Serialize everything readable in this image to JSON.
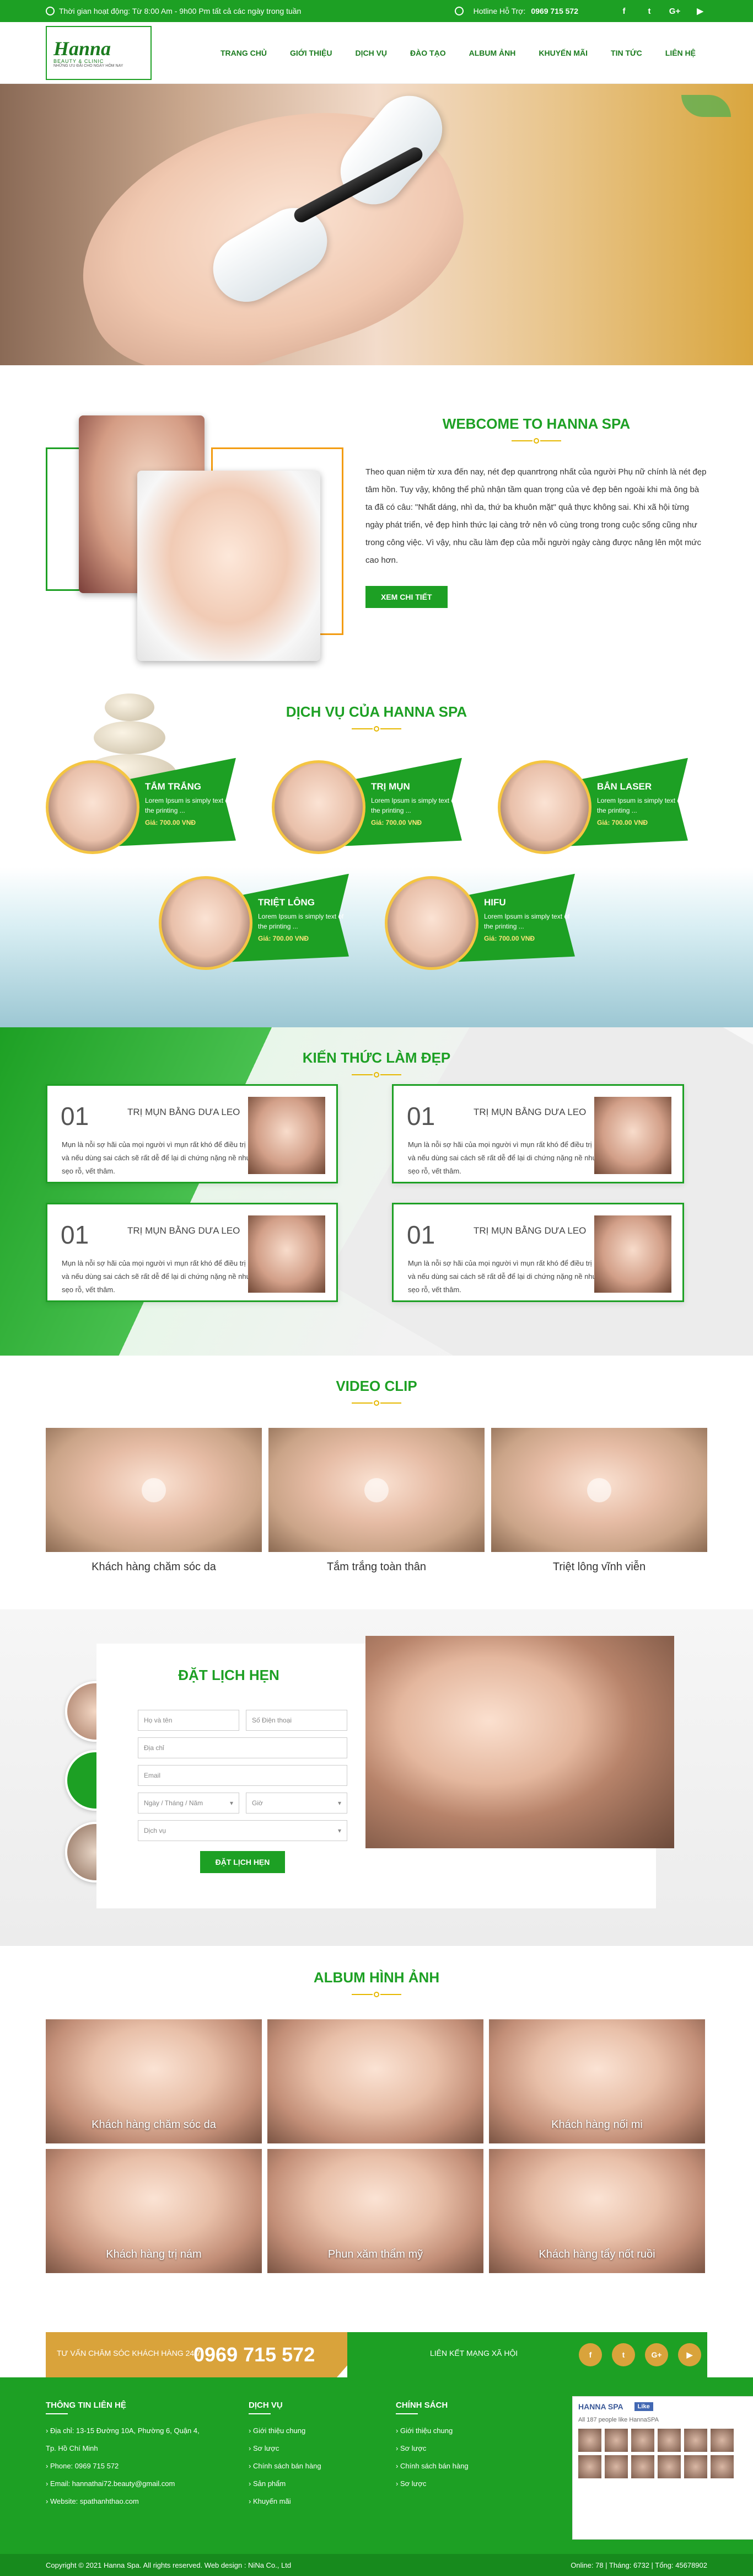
{
  "topbar": {
    "hours": "Thời gian hoạt động: Từ 8:00 Am - 9h00 Pm tất cả các ngày trong tuần",
    "hotline_label": "Hotline Hỗ Trợ:",
    "hotline": "0969 715 572",
    "social": [
      "f",
      "t",
      "G+",
      "▶"
    ]
  },
  "logo": {
    "name": "Hanna",
    "sub": "BEAUTY & CLINIC",
    "tag": "NHỮNG ƯU ĐÃI CHO NGÀY HÔM NAY"
  },
  "nav": [
    "TRANG CHỦ",
    "GIỚI THIỆU",
    "DỊCH VỤ",
    "ĐÀO TẠO",
    "ALBUM ẢNH",
    "KHUYẾN MÃI",
    "TIN TỨC",
    "LIÊN HỆ"
  ],
  "about": {
    "title": "WEBCOME TO HANNA SPA",
    "text": "Theo quan niệm từ xưa đến nay, nét đẹp quanrtrọng nhất của người Phụ nữ chính là nét đẹp tâm hồn. Tuy vậy, không thể phủ nhận tầm quan trọng của vẻ đẹp bên ngoài khi mà ông bà ta đã có câu: \"Nhất dáng, nhì da, thứ ba khuôn mặt\" quả thực không sai. Khi xã hội từng ngày phát triển, vẻ đẹp hình thức lại càng trở nên vô cùng trong trong cuộc sống cũng như trong công việc. Vì vậy, nhu cầu làm đẹp của mỗi người ngày càng được nâng lên một mức cao hơn.",
    "button": "XEM CHI TIẾT"
  },
  "services": {
    "title": "DỊCH VỤ CỦA HANNA SPA",
    "items": [
      {
        "name": "TẮM TRẮNG",
        "desc": "Lorem Ipsum is simply text of the printing ...",
        "price": "Giá: 700.00 VNĐ"
      },
      {
        "name": "TRỊ MỤN",
        "desc": "Lorem Ipsum is simply text of the printing ...",
        "price": "Giá: 700.00 VNĐ"
      },
      {
        "name": "BẮN LASER",
        "desc": "Lorem Ipsum is simply text of the printing ...",
        "price": "Giá: 700.00 VNĐ"
      },
      {
        "name": "TRIỆT LÔNG",
        "desc": "Lorem Ipsum is simply text of the printing ...",
        "price": "Giá: 700.00 VNĐ"
      },
      {
        "name": "HIFU",
        "desc": "Lorem Ipsum is simply text of the printing ...",
        "price": "Giá: 700.00 VNĐ"
      }
    ]
  },
  "knowledge": {
    "title": "KIẾN THỨC LÀM ĐẸP",
    "items": [
      {
        "no": "01",
        "name": "TRỊ MỤN BẰNG DƯA LEO",
        "desc": "Mụn là nỗi sợ hãi của mọi người vì mụn rất khó để điều trị và nếu dùng sai cách sẽ rất dễ để lại di chứng nặng nề như sẹo rỗ, vết thâm."
      },
      {
        "no": "01",
        "name": "TRỊ MỤN BẰNG DƯA LEO",
        "desc": "Mụn là nỗi sợ hãi của mọi người vì mụn rất khó để điều trị và nếu dùng sai cách sẽ rất dễ để lại di chứng nặng nề như sẹo rỗ, vết thâm."
      },
      {
        "no": "01",
        "name": "TRỊ MỤN BẰNG DƯA LEO",
        "desc": "Mụn là nỗi sợ hãi của mọi người vì mụn rất khó để điều trị và nếu dùng sai cách sẽ rất dễ để lại di chứng nặng nề như sẹo rỗ, vết thâm."
      },
      {
        "no": "01",
        "name": "TRỊ MỤN BẰNG DƯA LEO",
        "desc": "Mụn là nỗi sợ hãi của mọi người vì mụn rất khó để điều trị và nếu dùng sai cách sẽ rất dễ để lại di chứng nặng nề như sẹo rỗ, vết thâm."
      }
    ]
  },
  "video": {
    "title": "VIDEO CLIP",
    "items": [
      "Khách hàng chăm sóc da",
      "Tắm trắng toàn thân",
      "Triệt lông vĩnh viễn"
    ]
  },
  "booking": {
    "title": "ĐẶT LỊCH HẸN",
    "name_ph": "Họ và tên",
    "phone_ph": "Số Điện thoại",
    "address_ph": "Địa chỉ",
    "email_ph": "Email",
    "date_ph": "Ngày / Tháng / Năm",
    "time_ph": "Giờ",
    "service_ph": "Dịch vụ",
    "button": "ĐẶT LỊCH HẸN"
  },
  "album": {
    "title": "ALBUM HÌNH ẢNH",
    "items": [
      "Khách hàng chăm sóc da",
      "",
      "Khách hàng nối mi",
      "Khách hàng trị nám",
      "Phun xăm thẩm mỹ",
      "Khách hàng tẩy nốt ruồi"
    ]
  },
  "contactbar": {
    "label": "TƯ VẤN CHĂM SÓC KHÁCH HÀNG 24/7",
    "phone": "0969 715 572",
    "social_label": "LIÊN KẾT MẠNG XÃ HỘI",
    "social": [
      "f",
      "t",
      "G+",
      "▶"
    ]
  },
  "footer": {
    "contact_title": "THÔNG TIN LIÊN HỆ",
    "contact": [
      "Địa chỉ: 13-15 Đường 10A, Phường 6, Quận 4, Tp. Hồ Chí Minh",
      "Phone: 0969 715 572",
      "Email: hannathai72.beauty@gmail.com",
      "Website: spathanhthao.com"
    ],
    "services_title": "DỊCH VỤ",
    "services": [
      "Giới thiệu chung",
      "Sơ lược",
      "Chính sách bán hàng",
      "Sản phẩm",
      "Khuyến mãi"
    ],
    "policy_title": "CHÍNH SÁCH",
    "policy": [
      "Giới thiệu chung",
      "Sơ lược",
      "Chính sách bán hàng",
      "Sơ lược"
    ],
    "fb_name": "HANNA SPA",
    "fb_like": "Like",
    "fb_count": "All 187 people like HannaSPA",
    "copyright": "Copyright © 2021 Hanna Spa.  All rights reserved. Web design : NiNa Co., Ltd",
    "stats": "Online: 78 | Tháng: 6732 | Tổng: 45678902"
  }
}
